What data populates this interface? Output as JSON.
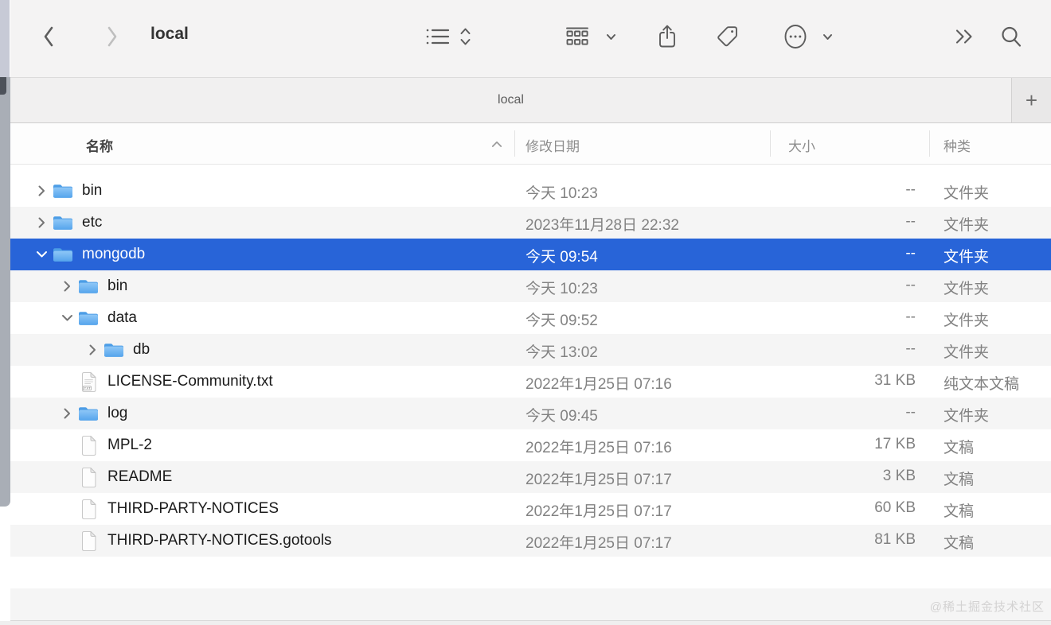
{
  "toolbar": {
    "title": "local",
    "icons": [
      "back-chevron",
      "forward-chevron",
      "list-view",
      "view-picker-updown",
      "group-by",
      "share",
      "tag",
      "more-ellipsis",
      "more-chevron",
      "overflow-double-chevron",
      "search"
    ]
  },
  "tabbar": {
    "tab_label": "local",
    "new_tab_label": "+"
  },
  "columns": {
    "name": "名称",
    "date": "修改日期",
    "size": "大小",
    "kind": "种类",
    "sort_icon": "chevron-up"
  },
  "files": [
    {
      "name": "bin",
      "date": "今天 10:23",
      "size": "--",
      "kind": "文件夹",
      "type": "folder",
      "level": 0,
      "state": "collapsed"
    },
    {
      "name": "etc",
      "date": "2023年11月28日 22:32",
      "size": "--",
      "kind": "文件夹",
      "type": "folder",
      "level": 0,
      "state": "collapsed"
    },
    {
      "name": "mongodb",
      "date": "今天 09:54",
      "size": "--",
      "kind": "文件夹",
      "type": "folder",
      "level": 0,
      "state": "expanded",
      "selected": true
    },
    {
      "name": "bin",
      "date": "今天 10:23",
      "size": "--",
      "kind": "文件夹",
      "type": "folder",
      "level": 1,
      "state": "collapsed"
    },
    {
      "name": "data",
      "date": "今天 09:52",
      "size": "--",
      "kind": "文件夹",
      "type": "folder",
      "level": 1,
      "state": "expanded"
    },
    {
      "name": "db",
      "date": "今天 13:02",
      "size": "--",
      "kind": "文件夹",
      "type": "folder",
      "level": 2,
      "state": "collapsed"
    },
    {
      "name": "LICENSE-Community.txt",
      "date": "2022年1月25日 07:16",
      "size": "31 KB",
      "kind": "纯文本文稿",
      "type": "txt",
      "level": 1
    },
    {
      "name": "log",
      "date": "今天 09:45",
      "size": "--",
      "kind": "文件夹",
      "type": "folder",
      "level": 1,
      "state": "collapsed"
    },
    {
      "name": "MPL-2",
      "date": "2022年1月25日 07:16",
      "size": "17 KB",
      "kind": "文稿",
      "type": "doc",
      "level": 1
    },
    {
      "name": "README",
      "date": "2022年1月25日 07:17",
      "size": "3 KB",
      "kind": "文稿",
      "type": "doc",
      "level": 1
    },
    {
      "name": "THIRD-PARTY-NOTICES",
      "date": "2022年1月25日 07:17",
      "size": "60 KB",
      "kind": "文稿",
      "type": "doc",
      "level": 1
    },
    {
      "name": "THIRD-PARTY-NOTICES.gotools",
      "date": "2022年1月25日 07:17",
      "size": "81 KB",
      "kind": "文稿",
      "type": "doc",
      "level": 1
    }
  ],
  "watermark": "@稀土掘金技术社区",
  "colors": {
    "selection": "#2864d8",
    "stripe": "#f5f5f5",
    "toolbar_bg": "#f4f3f3",
    "folder_blue": "#55a4ec",
    "secondary_text": "#828282"
  }
}
